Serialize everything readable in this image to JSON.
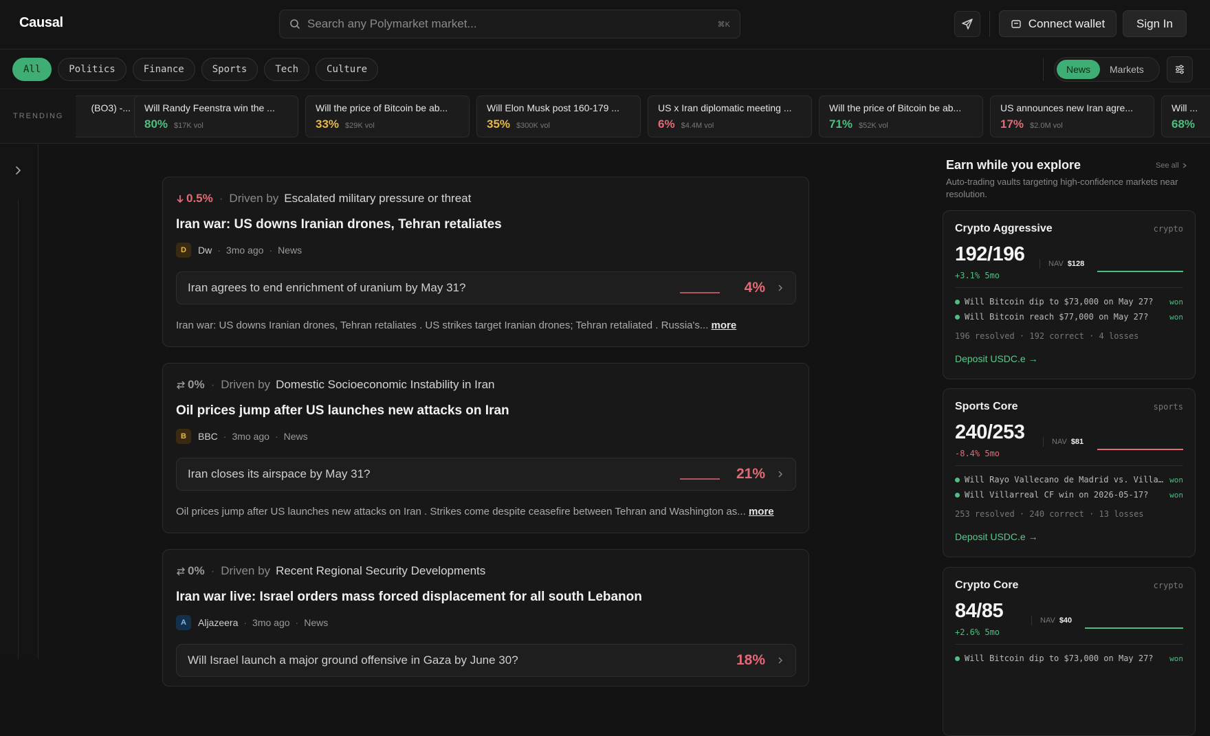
{
  "header": {
    "logo": "Causal",
    "search_placeholder": "Search any Polymarket market...",
    "search_shortcut": "⌘K",
    "connect_wallet": "Connect wallet",
    "sign_in": "Sign In"
  },
  "filters": {
    "chips": [
      "All",
      "Politics",
      "Finance",
      "Sports",
      "Tech",
      "Culture"
    ],
    "active_chip": "All",
    "view_toggle": [
      "News",
      "Markets"
    ],
    "active_view": "News"
  },
  "trending": {
    "label": "TRENDING",
    "items": [
      {
        "question": "(BO3) -...",
        "prob": "",
        "vol": "",
        "color": "green"
      },
      {
        "question": "Will Randy Feenstra win the ...",
        "prob": "80%",
        "vol": "$17K vol",
        "color": "green"
      },
      {
        "question": "Will the price of Bitcoin be ab...",
        "prob": "33%",
        "vol": "$29K vol",
        "color": "amber"
      },
      {
        "question": "Will Elon Musk post 160-179 ...",
        "prob": "35%",
        "vol": "$300K vol",
        "color": "amber"
      },
      {
        "question": "US x Iran diplomatic meeting ...",
        "prob": "6%",
        "vol": "$4.4M vol",
        "color": "red"
      },
      {
        "question": "Will the price of Bitcoin be ab...",
        "prob": "71%",
        "vol": "$52K vol",
        "color": "green"
      },
      {
        "question": "US announces new Iran agre...",
        "prob": "17%",
        "vol": "$2.0M vol",
        "color": "red"
      },
      {
        "question": "Will ...",
        "prob": "68%",
        "vol": "",
        "color": "green"
      }
    ]
  },
  "feed": [
    {
      "delta": "0.5%",
      "delta_dir": "down",
      "driven_label": "Driven by",
      "driver": "Escalated military pressure or threat",
      "title": "Iran war: US downs Iranian drones, Tehran retaliates",
      "source_initial": "D",
      "source": "Dw",
      "age": "3mo ago",
      "type": "News",
      "market_question": "Iran agrees to end enrichment of uranium by May 31?",
      "market_prob": "4%",
      "body": "Iran war: US downs Iranian drones, Tehran retaliates . US strikes target Iranian drones; Tehran retaliated . Russia's...",
      "more": "more"
    },
    {
      "delta": "0%",
      "delta_dir": "flat",
      "driven_label": "Driven by",
      "driver": "Domestic Socioeconomic Instability in Iran",
      "title": "Oil prices jump after US launches new attacks on Iran",
      "source_initial": "B",
      "source": "BBC",
      "age": "3mo ago",
      "type": "News",
      "market_question": "Iran closes its airspace by May 31?",
      "market_prob": "21%",
      "body": "Oil prices jump after US launches new attacks on Iran . Strikes come despite ceasefire between Tehran and Washington as...",
      "more": "more"
    },
    {
      "delta": "0%",
      "delta_dir": "flat",
      "driven_label": "Driven by",
      "driver": "Recent Regional Security Developments",
      "title": "Iran war live: Israel orders mass forced displacement for all south Lebanon",
      "source_initial": "A",
      "source": "Aljazeera",
      "age": "3mo ago",
      "type": "News",
      "market_question": "Will Israel launch a major ground offensive in Gaza by June 30?",
      "market_prob": "18%",
      "body": "",
      "more": ""
    }
  ],
  "right_panel": {
    "title": "Earn while you explore",
    "see_all": "See all",
    "subtitle": "Auto-trading vaults targeting high-confidence markets near resolution.",
    "vaults": [
      {
        "name": "Crypto Aggressive",
        "category": "crypto",
        "score": "192/196",
        "nav_label": "NAV",
        "nav": "$128",
        "return": "+3.1% 5mo",
        "return_dir": "up",
        "items": [
          {
            "q": "Will Bitcoin dip to $73,000 on May 27?",
            "result": "won"
          },
          {
            "q": "Will Bitcoin reach $77,000 on May 27?",
            "result": "won"
          }
        ],
        "stats": "196 resolved · 192 correct · 4 losses",
        "deposit": "Deposit USDC.e →"
      },
      {
        "name": "Sports Core",
        "category": "sports",
        "score": "240/253",
        "nav_label": "NAV",
        "nav": "$81",
        "return": "-8.4% 5mo",
        "return_dir": "down",
        "items": [
          {
            "q": "Will Rayo Vallecano de Madrid vs. Villarreal CF end in a draw?",
            "result": "won"
          },
          {
            "q": "Will Villarreal CF win on 2026-05-17?",
            "result": "won"
          }
        ],
        "stats": "253 resolved · 240 correct · 13 losses",
        "deposit": "Deposit USDC.e →"
      },
      {
        "name": "Crypto Core",
        "category": "crypto",
        "score": "84/85",
        "nav_label": "NAV",
        "nav": "$40",
        "return": "+2.6% 5mo",
        "return_dir": "up",
        "items": [
          {
            "q": "Will Bitcoin dip to $73,000 on May 27?",
            "result": "won"
          }
        ],
        "stats": "",
        "deposit": ""
      }
    ]
  },
  "colors": {
    "accent": "#3fae74",
    "up": "#4fbf80",
    "down": "#e46a75",
    "mid": "#e6b84a"
  }
}
